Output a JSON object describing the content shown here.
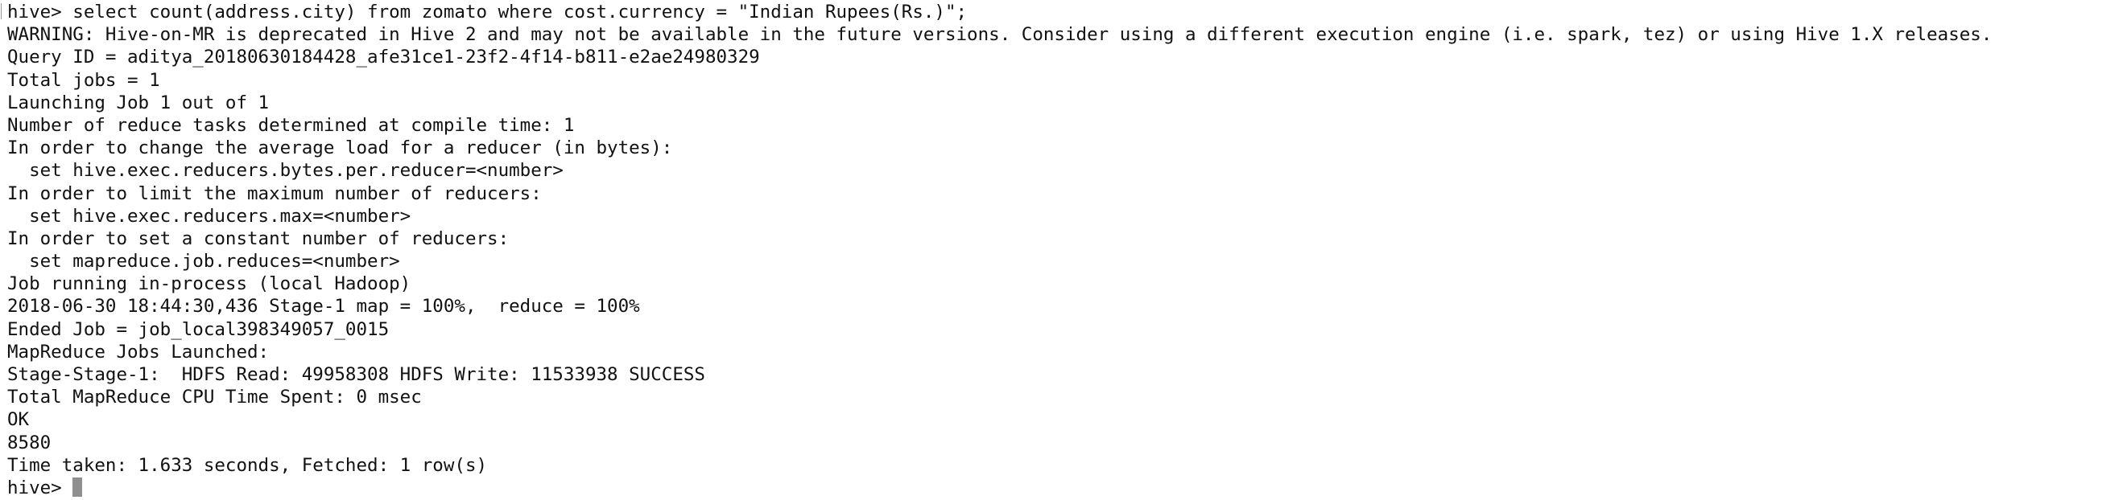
{
  "terminal": {
    "lines": [
      "hive> select count(address.city) from zomato where cost.currency = \"Indian Rupees(Rs.)\";",
      "WARNING: Hive-on-MR is deprecated in Hive 2 and may not be available in the future versions. Consider using a different execution engine (i.e. spark, tez) or using Hive 1.X releases.",
      "Query ID = aditya_20180630184428_afe31ce1-23f2-4f14-b811-e2ae24980329",
      "Total jobs = 1",
      "Launching Job 1 out of 1",
      "Number of reduce tasks determined at compile time: 1",
      "In order to change the average load for a reducer (in bytes):",
      "  set hive.exec.reducers.bytes.per.reducer=<number>",
      "In order to limit the maximum number of reducers:",
      "  set hive.exec.reducers.max=<number>",
      "In order to set a constant number of reducers:",
      "  set mapreduce.job.reduces=<number>",
      "Job running in-process (local Hadoop)",
      "2018-06-30 18:44:30,436 Stage-1 map = 100%,  reduce = 100%",
      "Ended Job = job_local398349057_0015",
      "MapReduce Jobs Launched:",
      "Stage-Stage-1:  HDFS Read: 49958308 HDFS Write: 11533938 SUCCESS",
      "Total MapReduce CPU Time Spent: 0 msec",
      "OK",
      "8580",
      "Time taken: 1.633 seconds, Fetched: 1 row(s)"
    ],
    "prompt": "hive> "
  }
}
